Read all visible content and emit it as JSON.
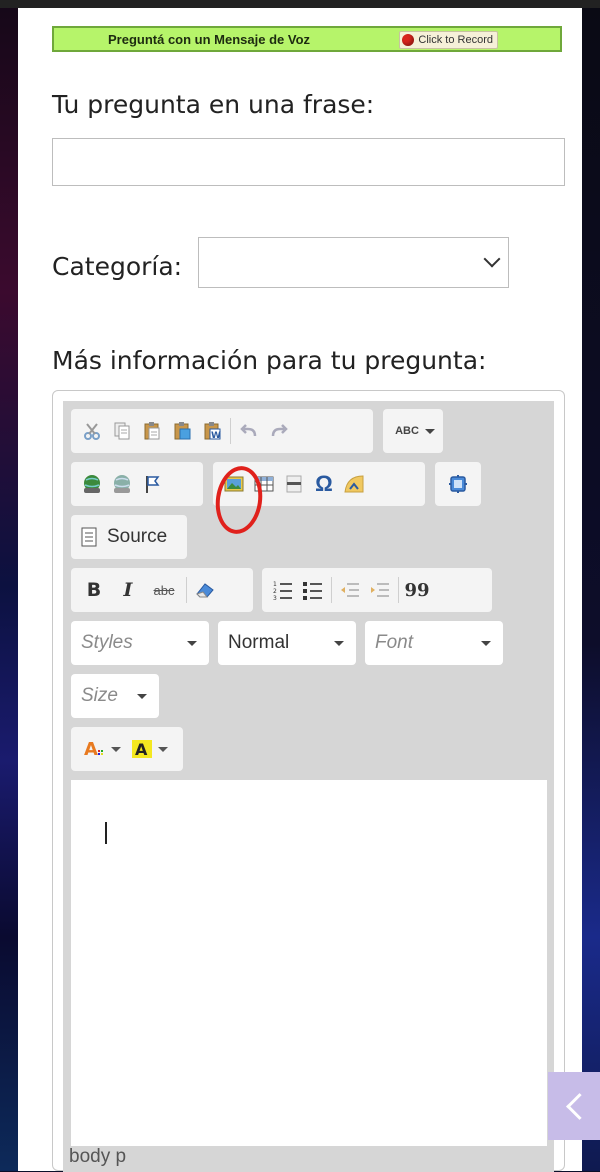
{
  "voice": {
    "label": "Preguntá con un Mensaje de Voz",
    "record_label": "Click to Record"
  },
  "form": {
    "question_label": "Tu pregunta en una frase:",
    "question_value": "",
    "category_label": "Categoría:",
    "category_value": "",
    "info_label": "Más información para tu pregunta:"
  },
  "editor": {
    "toolbar_row1": [
      "cut-icon",
      "copy-icon",
      "paste-icon",
      "paste-text-icon",
      "paste-word-icon",
      "undo-icon",
      "redo-icon",
      "spellcheck-icon"
    ],
    "toolbar_row2": [
      "link-icon",
      "unlink-icon",
      "anchor-icon",
      "image-icon",
      "table-icon",
      "horizontal-line-icon",
      "special-char-icon",
      "iframe-icon",
      "maximize-icon"
    ],
    "source_label": "Source",
    "bold_glyph": "B",
    "italic_glyph": "I",
    "strike_glyph": "abc",
    "spell_glyph": "ABC",
    "omega_glyph": "Ω",
    "quote_glyph": "99",
    "styles_label": "Styles",
    "format_label": "Normal",
    "font_label": "Font",
    "size_label": "Size",
    "status_path": "body  p"
  },
  "colors": {
    "voice_bg": "#b6f46a",
    "record_dot": "#d8241c",
    "annotation": "#e0211c",
    "side_tab": "#c7bce8"
  }
}
